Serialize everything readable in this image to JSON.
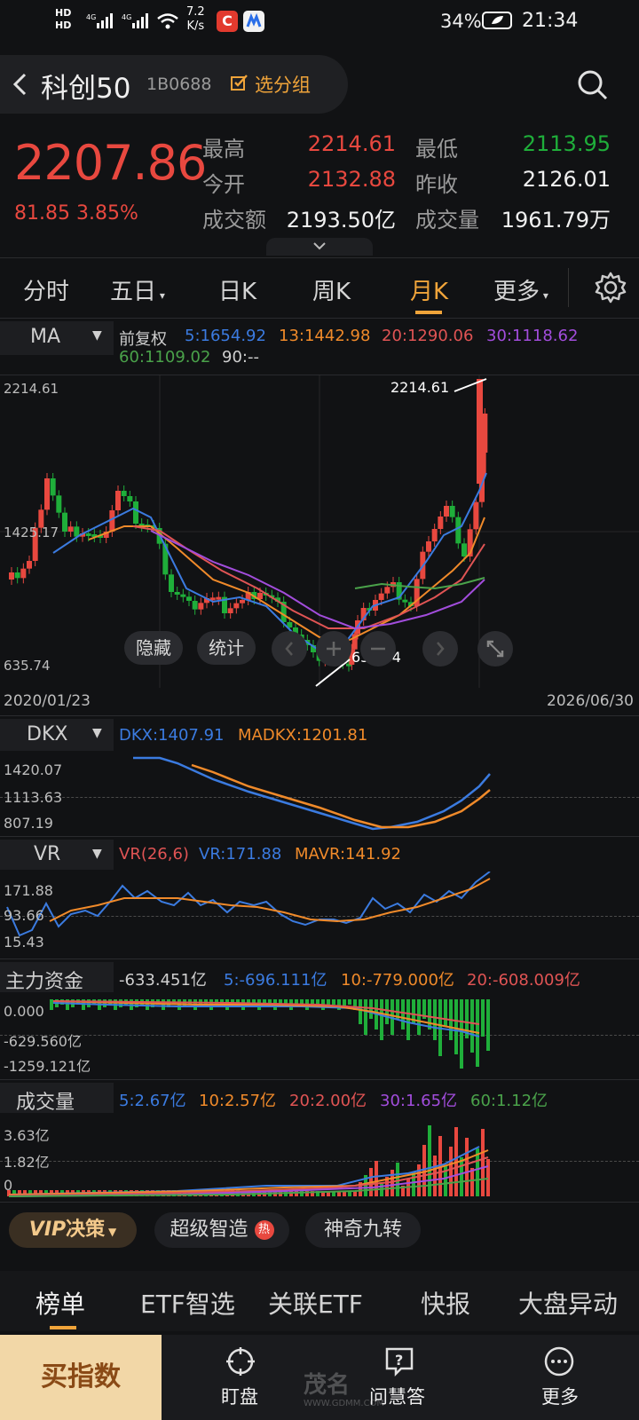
{
  "status_bar": {
    "net_speed_value": "7.2",
    "net_speed_unit": "K/s",
    "battery": "34%",
    "time": "21:34",
    "hd1": "HD",
    "hd2": "HD",
    "sig1": "4G",
    "sig2": "4G"
  },
  "header": {
    "back_icon": "chevron-left-icon",
    "title": "科创50",
    "code": "1B0688",
    "add_group_label": "选分组",
    "search_icon": "search-icon"
  },
  "quote": {
    "price": "2207.86",
    "change": "81.85",
    "change_pct": "3.85%",
    "high_label": "最高",
    "high": "2214.61",
    "low_label": "最低",
    "low": "2113.95",
    "open_label": "今开",
    "open": "2132.88",
    "prev_close_label": "昨收",
    "prev_close": "2126.01",
    "amount_label": "成交额",
    "amount": "2193.50亿",
    "volume_label": "成交量",
    "volume": "1961.79万"
  },
  "tabs": {
    "items": [
      "分时",
      "五日",
      "日K",
      "周K",
      "月K",
      "更多"
    ],
    "active": "月K"
  },
  "ma_panel": {
    "label": "MA",
    "adj": "前复权",
    "ma5": "5:1654.92",
    "ma13": "13:1442.98",
    "ma20": "20:1290.06",
    "ma30": "30:1118.62",
    "ma60": "60:1109.02",
    "ma90": "90:--",
    "y_top": "2214.61",
    "y_mid": "1425.17",
    "y_bot": "635.74",
    "max_label": "2214.61",
    "min_label": "635.74",
    "date_start": "2020/01/23",
    "date_end": "2026/06/30",
    "hide_label": "隐藏",
    "stats_label": "统计"
  },
  "dkx_panel": {
    "label": "DKX",
    "dkx": "DKX:1407.91",
    "madkx": "MADKX:1201.81",
    "y_top": "1420.07",
    "y_mid": "1113.63",
    "y_bot": "807.19"
  },
  "vr_panel": {
    "label": "VR",
    "params": "VR(26,6)",
    "vr": "VR:171.88",
    "mavr": "MAVR:141.92",
    "y_top": "171.88",
    "y_mid": "93.66",
    "y_bot": "15.43"
  },
  "fund_panel": {
    "label": "主力资金",
    "value": "-633.451亿",
    "ma5": "5:-696.111亿",
    "ma10": "10:-779.000亿",
    "ma20": "20:-608.009亿",
    "y_top": "0.000",
    "y_mid": "-629.560亿",
    "y_bot": "-1259.121亿"
  },
  "vol_panel": {
    "label": "成交量",
    "ma5": "5:2.67亿",
    "ma10": "10:2.57亿",
    "ma20": "20:2.00亿",
    "ma30": "30:1.65亿",
    "ma60": "60:1.12亿",
    "y_top": "3.63亿",
    "y_mid": "1.82亿",
    "y_bot": "0"
  },
  "chips": {
    "vip": "VIP",
    "decision": "决策",
    "super": "超级智造",
    "hot_badge": "热",
    "nine": "神奇九转"
  },
  "bottom_tabs": [
    "榜单",
    "ETF智选",
    "关联ETF",
    "快报",
    "大盘异动"
  ],
  "bottom_nav": {
    "buy": "买指数",
    "watch": "盯盘",
    "ask": "问慧答",
    "more": "更多"
  },
  "watermark": {
    "site": "WWW.GDMM.COM",
    "brand": "茂名"
  },
  "colors": {
    "up": "#e8483f",
    "down": "#1fae3a",
    "ma5": "#3b7be0",
    "ma13": "#f08a2a",
    "ma20": "#e05454",
    "ma30": "#a24ddc",
    "ma60": "#4aa24a",
    "accent_tab": "#f0a43a"
  }
}
